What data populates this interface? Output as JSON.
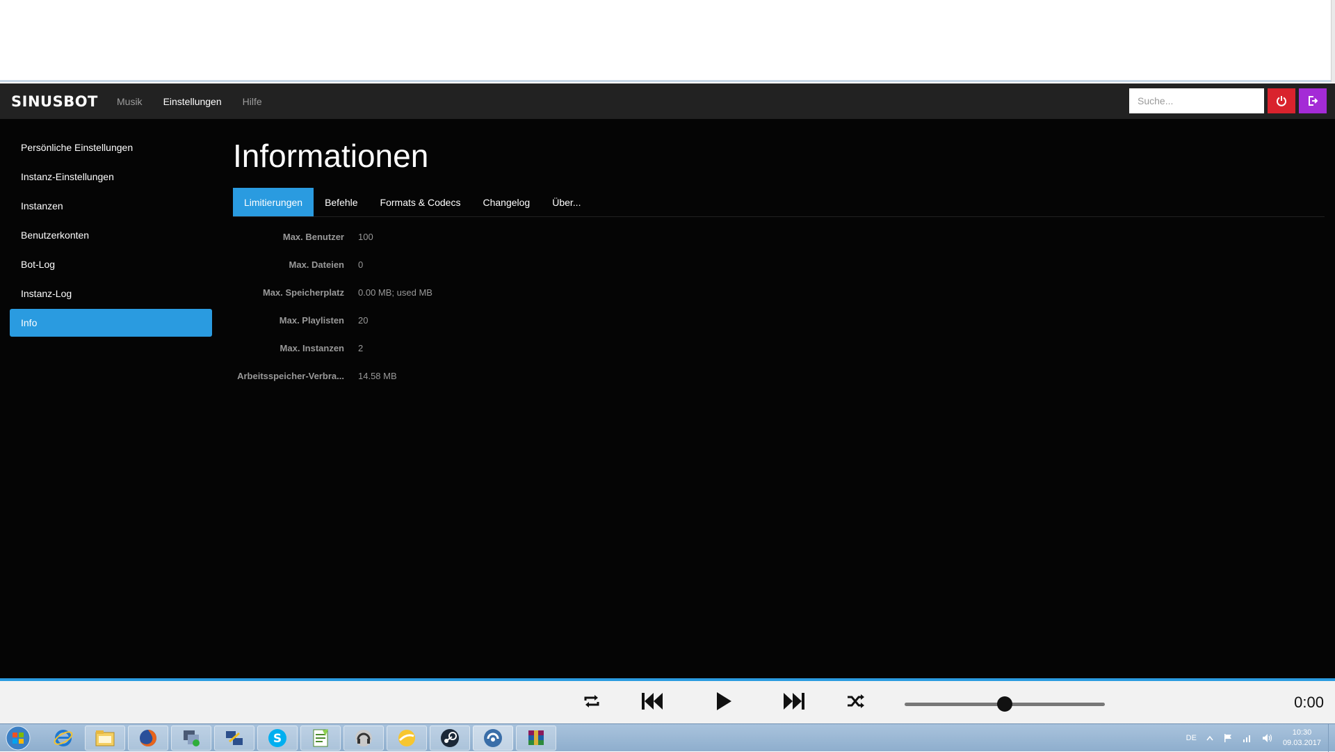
{
  "navbar": {
    "brand": "SINUSBOT",
    "links": [
      "Musik",
      "Einstellungen",
      "Hilfe"
    ],
    "active_link": "Einstellungen",
    "search_placeholder": "Suche...",
    "power_icon": "power-icon",
    "logout_icon": "logout-icon"
  },
  "sidebar": {
    "items": [
      {
        "label": "Persönliche Einstellungen"
      },
      {
        "label": "Instanz-Einstellungen"
      },
      {
        "label": "Instanzen"
      },
      {
        "label": "Benutzerkonten"
      },
      {
        "label": "Bot-Log"
      },
      {
        "label": "Instanz-Log"
      },
      {
        "label": "Info",
        "active": true
      }
    ]
  },
  "main": {
    "title": "Informationen",
    "tabs": [
      {
        "label": "Limitierungen",
        "active": true
      },
      {
        "label": "Befehle"
      },
      {
        "label": "Formats & Codecs"
      },
      {
        "label": "Changelog"
      },
      {
        "label": "Über..."
      }
    ],
    "info": [
      {
        "label": "Max. Benutzer",
        "value": "100"
      },
      {
        "label": "Max. Dateien",
        "value": "0"
      },
      {
        "label": "Max. Speicherplatz",
        "value": "0.00 MB; used MB"
      },
      {
        "label": "Max. Playlisten",
        "value": "20"
      },
      {
        "label": "Max. Instanzen",
        "value": "2"
      },
      {
        "label": "Arbeitsspeicher-Verbra...",
        "value": "14.58 MB"
      }
    ]
  },
  "player": {
    "time": "0:00",
    "volume_fraction": 0.5,
    "controls": [
      "repeat-icon",
      "previous-icon",
      "play-icon",
      "next-icon",
      "shuffle-icon"
    ]
  },
  "taskbar": {
    "language": "DE",
    "clock_time": "10:30",
    "clock_date": "09.03.2017",
    "apps": [
      "internet-explorer-icon",
      "file-explorer-icon",
      "firefox-icon",
      "network-tool-icon",
      "remote-desktop-icon",
      "skype-icon",
      "notepad-plus-icon",
      "headset-app-icon",
      "yellow-app-icon",
      "steam-icon",
      "teamspeak-icon",
      "winrar-icon"
    ]
  },
  "colors": {
    "accent": "#2a9be0",
    "power": "#d9232d",
    "logout": "#a42bd6"
  }
}
